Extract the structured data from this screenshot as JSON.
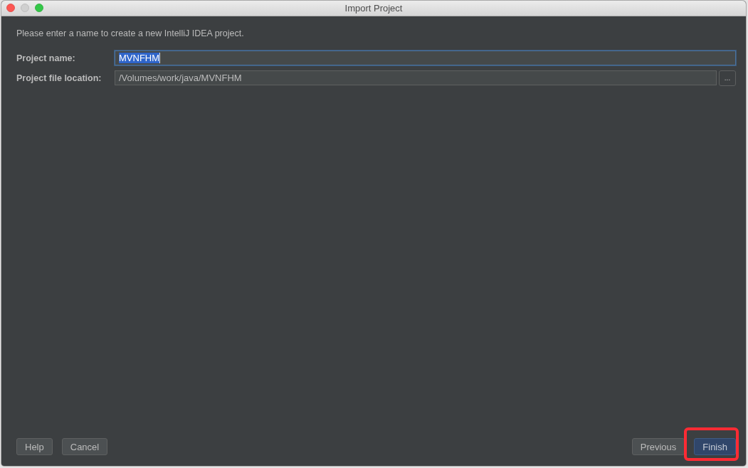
{
  "window": {
    "title": "Import Project"
  },
  "description": "Please enter a name to create a new IntelliJ IDEA project.",
  "fields": [
    {
      "label": "Project name:",
      "value": "MVNFHM",
      "focused": true,
      "text_selected": true
    },
    {
      "label": "Project file location:",
      "value": "/Volumes/work/java/MVNFHM",
      "focused": false,
      "text_selected": false,
      "browse_button": "..."
    }
  ],
  "buttons_left": [
    {
      "label": "Help",
      "default": false,
      "highlighted": false
    },
    {
      "label": "Cancel",
      "default": false,
      "highlighted": false
    }
  ],
  "buttons_right": [
    {
      "label": "Previous",
      "default": false,
      "highlighted": false
    },
    {
      "label": "Finish",
      "default": true,
      "highlighted": true
    }
  ]
}
